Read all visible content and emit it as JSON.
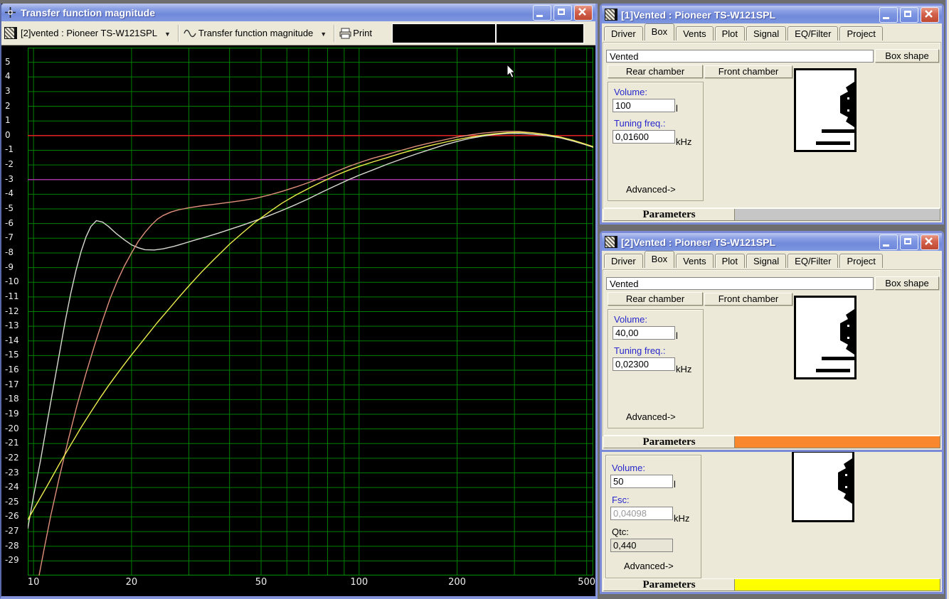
{
  "plot_window": {
    "title": "Transfer function magnitude",
    "toolbar": {
      "project_dropdown": "[2]vented : Pioneer TS-W121SPL",
      "graph_dropdown": "Transfer function magnitude",
      "print_label": "Print"
    }
  },
  "chart_data": {
    "type": "line",
    "title": "Transfer function magnitude",
    "x_axis": {
      "scale": "log",
      "unit": "Hz",
      "range": [
        9.6,
        524
      ],
      "tick_labels": [
        10,
        20,
        50,
        100,
        200,
        500
      ],
      "gridline_freqs": [
        10,
        20,
        30,
        40,
        50,
        60,
        70,
        80,
        90,
        100,
        200,
        300,
        400,
        500
      ]
    },
    "y_axis": {
      "unit": "dB",
      "range": [
        -30,
        6
      ],
      "tick_label_max": 5,
      "tick_label_min": -29,
      "tick_step": 1
    },
    "grid_color": "#008000",
    "plot_bg": "#000000",
    "reference_lines": [
      {
        "db": 0,
        "color": "#d42020"
      },
      {
        "db": -3,
        "color": "#a232a2"
      }
    ],
    "series": [
      {
        "name": "vented-100l-16hz-white",
        "color": "#d9d9d1",
        "points": [
          [
            9.6,
            -26.8
          ],
          [
            10,
            -24.6
          ],
          [
            10.5,
            -22.2
          ],
          [
            11,
            -19.6
          ],
          [
            11.5,
            -17.2
          ],
          [
            12,
            -14.9
          ],
          [
            12.5,
            -12.7
          ],
          [
            13,
            -10.8
          ],
          [
            13.5,
            -9.2
          ],
          [
            14,
            -7.9
          ],
          [
            14.5,
            -6.9
          ],
          [
            15,
            -6.2
          ],
          [
            15.6,
            -5.8
          ],
          [
            16.3,
            -5.9
          ],
          [
            17,
            -6.2
          ],
          [
            18,
            -6.7
          ],
          [
            19,
            -7.1
          ],
          [
            20,
            -7.45
          ],
          [
            21,
            -7.65
          ],
          [
            22,
            -7.78
          ],
          [
            23.5,
            -7.8
          ],
          [
            25,
            -7.72
          ],
          [
            27,
            -7.55
          ],
          [
            29,
            -7.35
          ],
          [
            31,
            -7.15
          ],
          [
            34,
            -6.9
          ],
          [
            37,
            -6.65
          ],
          [
            40,
            -6.4
          ],
          [
            44,
            -6.1
          ],
          [
            48,
            -5.8
          ],
          [
            53,
            -5.45
          ],
          [
            58,
            -5.1
          ],
          [
            64,
            -4.7
          ],
          [
            70,
            -4.3
          ],
          [
            77,
            -3.85
          ],
          [
            85,
            -3.4
          ],
          [
            93,
            -3.0
          ],
          [
            100,
            -2.7
          ],
          [
            110,
            -2.35
          ],
          [
            122,
            -1.95
          ],
          [
            135,
            -1.6
          ],
          [
            150,
            -1.25
          ],
          [
            165,
            -0.95
          ],
          [
            182,
            -0.65
          ],
          [
            200,
            -0.4
          ],
          [
            220,
            -0.18
          ],
          [
            240,
            -0.03
          ],
          [
            262,
            0.08
          ],
          [
            285,
            0.14
          ],
          [
            310,
            0.15
          ],
          [
            340,
            0.1
          ],
          [
            375,
            0.0
          ],
          [
            415,
            -0.15
          ],
          [
            455,
            -0.38
          ],
          [
            495,
            -0.62
          ],
          [
            524,
            -0.8
          ]
        ]
      },
      {
        "name": "vented-40l-23hz-salmon",
        "color": "#df8f7b",
        "points": [
          [
            10.4,
            -30
          ],
          [
            10.8,
            -28.1
          ],
          [
            11.3,
            -25.9
          ],
          [
            12,
            -23.3
          ],
          [
            12.8,
            -20.7
          ],
          [
            13.6,
            -18.4
          ],
          [
            14.5,
            -16.2
          ],
          [
            15.4,
            -14.3
          ],
          [
            16.3,
            -12.6
          ],
          [
            17.2,
            -11.1
          ],
          [
            18.1,
            -9.9
          ],
          [
            19,
            -8.9
          ],
          [
            20,
            -8.0
          ],
          [
            21,
            -7.2
          ],
          [
            22,
            -6.6
          ],
          [
            23,
            -6.1
          ],
          [
            24,
            -5.7
          ],
          [
            25,
            -5.45
          ],
          [
            26.5,
            -5.2
          ],
          [
            28,
            -5.05
          ],
          [
            30,
            -4.92
          ],
          [
            33,
            -4.78
          ],
          [
            36,
            -4.68
          ],
          [
            40,
            -4.55
          ],
          [
            44,
            -4.42
          ],
          [
            48,
            -4.28
          ],
          [
            53,
            -4.05
          ],
          [
            58,
            -3.8
          ],
          [
            64,
            -3.5
          ],
          [
            70,
            -3.2
          ],
          [
            77,
            -2.85
          ],
          [
            85,
            -2.45
          ],
          [
            93,
            -2.1
          ],
          [
            100,
            -1.85
          ],
          [
            110,
            -1.55
          ],
          [
            122,
            -1.28
          ],
          [
            135,
            -1.0
          ],
          [
            150,
            -0.72
          ],
          [
            165,
            -0.5
          ],
          [
            182,
            -0.3
          ],
          [
            200,
            -0.1
          ],
          [
            220,
            0.05
          ],
          [
            240,
            0.17
          ],
          [
            262,
            0.25
          ],
          [
            285,
            0.29
          ],
          [
            310,
            0.28
          ],
          [
            340,
            0.2
          ],
          [
            375,
            0.08
          ],
          [
            415,
            -0.1
          ],
          [
            455,
            -0.33
          ],
          [
            495,
            -0.58
          ],
          [
            524,
            -0.76
          ]
        ]
      },
      {
        "name": "closed-50l-yellow",
        "color": "#eded4d",
        "points": [
          [
            9.6,
            -26.2
          ],
          [
            10,
            -25.5
          ],
          [
            11,
            -23.9
          ],
          [
            12,
            -22.4
          ],
          [
            13,
            -21.1
          ],
          [
            14,
            -19.9
          ],
          [
            15,
            -18.85
          ],
          [
            16,
            -17.9
          ],
          [
            17,
            -17.05
          ],
          [
            18,
            -16.3
          ],
          [
            19,
            -15.6
          ],
          [
            20,
            -14.95
          ],
          [
            22,
            -13.8
          ],
          [
            24,
            -12.75
          ],
          [
            26,
            -11.85
          ],
          [
            28,
            -11.0
          ],
          [
            30,
            -10.25
          ],
          [
            33,
            -9.25
          ],
          [
            36,
            -8.4
          ],
          [
            40,
            -7.4
          ],
          [
            44,
            -6.6
          ],
          [
            48,
            -5.9
          ],
          [
            53,
            -5.2
          ],
          [
            58,
            -4.6
          ],
          [
            64,
            -4.05
          ],
          [
            70,
            -3.6
          ],
          [
            77,
            -3.15
          ],
          [
            85,
            -2.7
          ],
          [
            93,
            -2.35
          ],
          [
            100,
            -2.1
          ],
          [
            110,
            -1.8
          ],
          [
            122,
            -1.5
          ],
          [
            135,
            -1.2
          ],
          [
            150,
            -0.92
          ],
          [
            165,
            -0.68
          ],
          [
            182,
            -0.47
          ],
          [
            200,
            -0.27
          ],
          [
            220,
            -0.1
          ],
          [
            240,
            0.03
          ],
          [
            262,
            0.13
          ],
          [
            285,
            0.2
          ],
          [
            310,
            0.23
          ],
          [
            340,
            0.18
          ],
          [
            375,
            0.07
          ],
          [
            415,
            -0.1
          ],
          [
            455,
            -0.33
          ],
          [
            495,
            -0.58
          ],
          [
            524,
            -0.76
          ]
        ]
      }
    ]
  },
  "win1": {
    "title": "[1]Vented : Pioneer TS-W121SPL",
    "tabs": [
      "Driver",
      "Box",
      "Vents",
      "Plot",
      "Signal",
      "EQ/Filter",
      "Project"
    ],
    "active_tab": "Box",
    "enclosure_type": "Vented",
    "box_shape_button": "Box shape",
    "rear_chamber": "Rear chamber",
    "front_chamber": "Front chamber",
    "volume_label": "Volume:",
    "volume_value": "100",
    "volume_unit": "l",
    "tuning_label": "Tuning freq.:",
    "tuning_value": "0,01600",
    "tuning_unit": "kHz",
    "advanced_label": "Advanced->",
    "parameters_label": "Parameters",
    "stripe_color": "#c6c6c6"
  },
  "win2": {
    "title": "[2]Vented : Pioneer TS-W121SPL",
    "tabs": [
      "Driver",
      "Box",
      "Vents",
      "Plot",
      "Signal",
      "EQ/Filter",
      "Project"
    ],
    "active_tab": "Box",
    "enclosure_type": "Vented",
    "box_shape_button": "Box shape",
    "rear_chamber": "Rear chamber",
    "front_chamber": "Front chamber",
    "volume_label": "Volume:",
    "volume_value": "40,00",
    "volume_unit": "l",
    "tuning_label": "Tuning freq.:",
    "tuning_value": "0,02300",
    "tuning_unit": "kHz",
    "advanced_label": "Advanced->",
    "parameters_label": "Parameters",
    "stripe_color": "#f8872e"
  },
  "win3": {
    "volume_label": "Volume:",
    "volume_value": "50",
    "volume_unit": "l",
    "fsc_label": "Fsc:",
    "fsc_value": "0,04098",
    "fsc_unit": "kHz",
    "qtc_label": "Qtc:",
    "qtc_value": "0,440",
    "advanced_label": "Advanced->",
    "parameters_label": "Parameters",
    "stripe_color": "#ffff00"
  }
}
